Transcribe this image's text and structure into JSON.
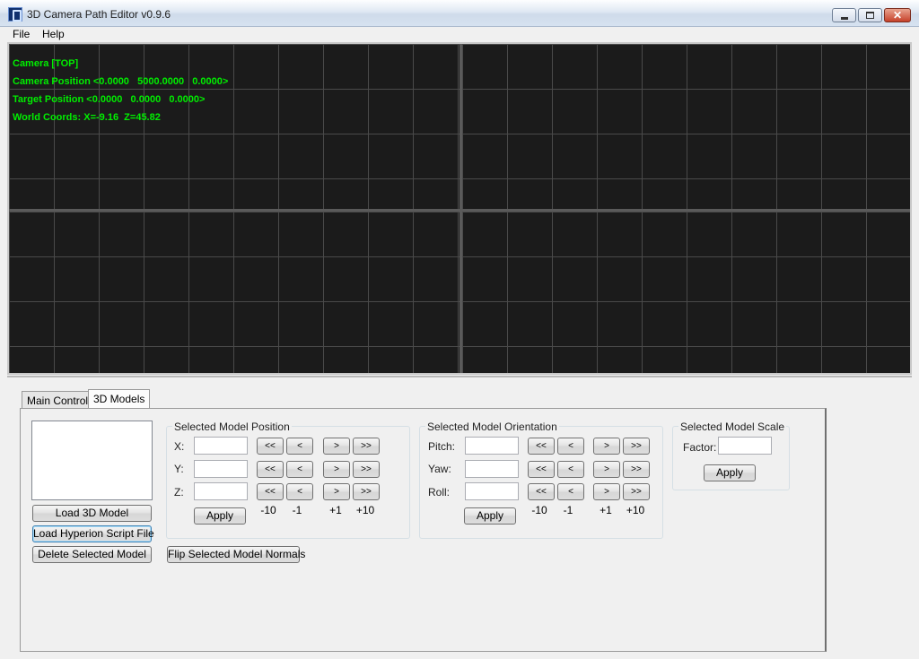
{
  "window": {
    "title": "3D Camera Path Editor v0.9.6",
    "icon": "app-icon",
    "controls": [
      "minimize-icon",
      "maximize-icon",
      "close-icon"
    ]
  },
  "menu": {
    "file": "File",
    "help": "Help"
  },
  "viewport": {
    "camera_label": "Camera [TOP]",
    "camera_position": "Camera Position <0.0000   5000.0000   0.0000>",
    "target_position": "Target Position <0.0000   0.0000   0.0000>",
    "world_coords": "World Coords: X=-9.16  Z=45.82",
    "overlay_color": "#00ee00"
  },
  "tabs": {
    "main_controls": "Main Controls",
    "models": "3D Models"
  },
  "models_panel": {
    "load_model": "Load 3D Model",
    "load_script": "Load Hyperion Script File",
    "delete_model": "Delete Selected Model",
    "flip_normals": "Flip Selected Model Normals"
  },
  "position": {
    "title": "Selected Model Position",
    "x_label": "X:",
    "y_label": "Y:",
    "z_label": "Z:",
    "apply": "Apply"
  },
  "orientation": {
    "title": "Selected Model Orientation",
    "pitch_label": "Pitch:",
    "yaw_label": "Yaw:",
    "roll_label": "Roll:",
    "apply": "Apply"
  },
  "scale": {
    "title": "Selected Model Scale",
    "factor_label": "Factor:",
    "apply": "Apply"
  },
  "steppers": {
    "dec10": "<<",
    "dec1": "<",
    "inc1": ">",
    "inc10": ">>",
    "label_dec10": "-10",
    "label_dec1": "-1",
    "label_inc1": "+1",
    "label_inc10": "+10"
  }
}
